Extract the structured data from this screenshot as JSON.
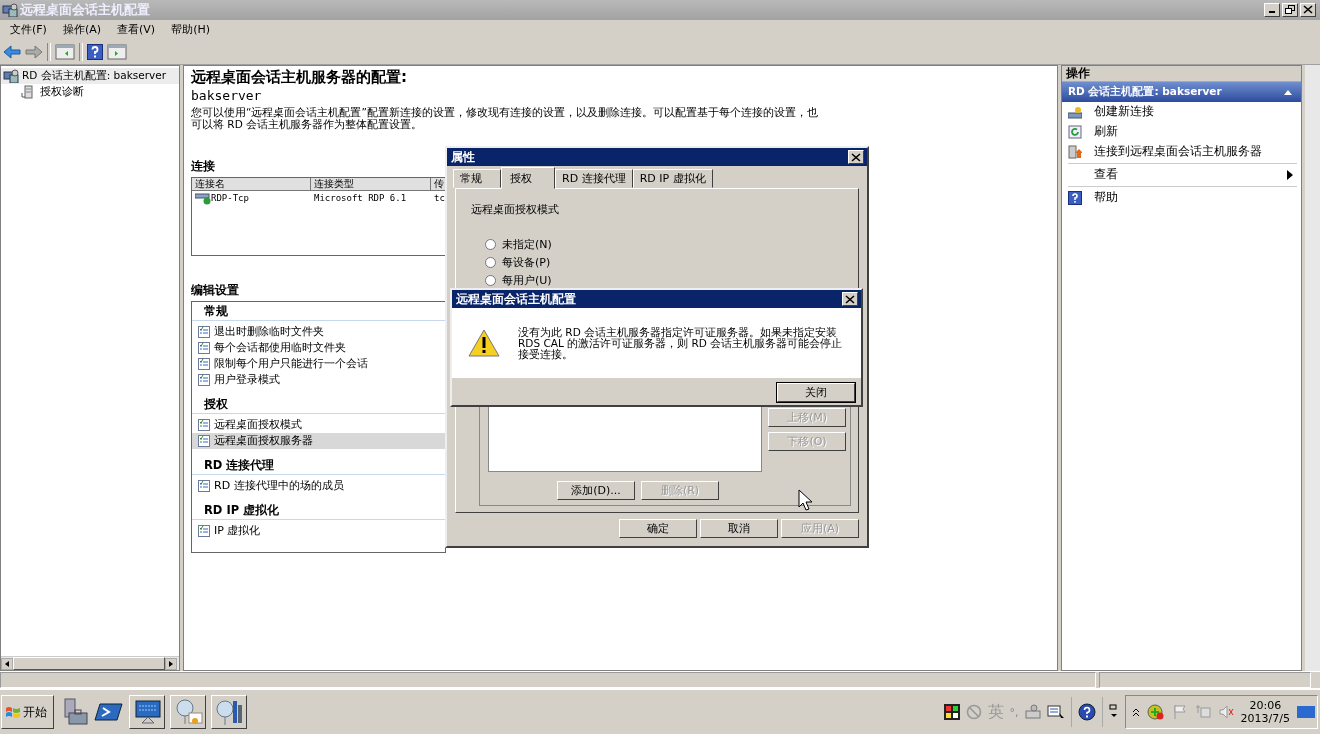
{
  "window": {
    "title": "远程桌面会话主机配置"
  },
  "menu": [
    "文件(F)",
    "操作(A)",
    "查看(V)",
    "帮助(H)"
  ],
  "tree": [
    {
      "label": "RD 会话主机配置: bakserver",
      "selected": true,
      "children": [
        {
          "label": "授权诊断",
          "selected": false
        }
      ]
    }
  ],
  "main": {
    "heading": "远程桌面会话主机服务器的配置:",
    "server": "bakserver",
    "description": "您可以使用“远程桌面会话主机配置”配置新连接的设置，修改现有连接的设置，以及删除连接。可以配置基于每个连接的设置，也可以将 RD 会话主机服务器作为整体配置设置。"
  },
  "connections": {
    "title": "连接",
    "columns": [
      "连接名",
      "连接类型",
      "传"
    ],
    "rows": [
      [
        "RDP-Tcp",
        "Microsoft RDP 6.1",
        "tc"
      ]
    ]
  },
  "settings": {
    "title": "编辑设置",
    "groups": [
      {
        "title": "常规",
        "items": [
          {
            "label": "退出时删除临时文件夹",
            "selected": false
          },
          {
            "label": "每个会话都使用临时文件夹",
            "selected": false
          },
          {
            "label": "限制每个用户只能进行一个会话",
            "selected": false
          },
          {
            "label": "用户登录模式",
            "selected": false
          }
        ]
      },
      {
        "title": "授权",
        "items": [
          {
            "label": "远程桌面授权模式",
            "selected": false
          },
          {
            "label": "远程桌面授权服务器",
            "selected": true
          }
        ]
      },
      {
        "title": "RD 连接代理",
        "items": [
          {
            "label": "RD 连接代理中的场的成员",
            "selected": false
          }
        ]
      },
      {
        "title": "RD IP 虚拟化",
        "items": [
          {
            "label": "IP 虚拟化",
            "selected": false
          }
        ]
      }
    ]
  },
  "actions": {
    "title": "操作",
    "section": "RD 会话主机配置: bakserver",
    "items": [
      {
        "label": "创建新连接",
        "kind": "command"
      },
      {
        "label": "刷新",
        "kind": "command"
      },
      {
        "label": "连接到远程桌面会话主机服务器",
        "kind": "command"
      },
      {
        "label": "查看",
        "kind": "submenu"
      },
      {
        "label": "帮助",
        "kind": "command"
      }
    ]
  },
  "properties_dialog": {
    "title": "属性",
    "tabs": [
      {
        "label": "常规",
        "selected": false
      },
      {
        "label": "授权",
        "selected": true
      },
      {
        "label": "RD 连接代理",
        "selected": false
      },
      {
        "label": "RD IP 虚拟化",
        "selected": false
      }
    ],
    "mode_label": "远程桌面授权模式",
    "radios": [
      {
        "label": "未指定(N)",
        "checked": false
      },
      {
        "label": "每设备(P)",
        "checked": false
      },
      {
        "label": "每用户(U)",
        "checked": false
      }
    ],
    "move_buttons": [
      {
        "label": "上移(M)",
        "disabled": true
      },
      {
        "label": "下移(O)",
        "disabled": true
      }
    ],
    "list_buttons": [
      {
        "label": "添加(D)...",
        "disabled": false
      },
      {
        "label": "删除(R)",
        "disabled": true
      }
    ],
    "buttons": [
      {
        "label": "确定",
        "disabled": false
      },
      {
        "label": "取消",
        "disabled": false
      },
      {
        "label": "应用(A)",
        "disabled": true
      }
    ]
  },
  "message_box": {
    "title": "远程桌面会话主机配置",
    "message": "没有为此 RD 会话主机服务器指定许可证服务器。如果未指定安装 RDS CAL 的激活许可证服务器，则 RD 会话主机服务器可能会停止接受连接。",
    "button": "关闭"
  },
  "taskbar": {
    "start": "开始",
    "ime": "英",
    "ime_punct": "°,",
    "time": "20:06",
    "date": "2013/7/5"
  }
}
